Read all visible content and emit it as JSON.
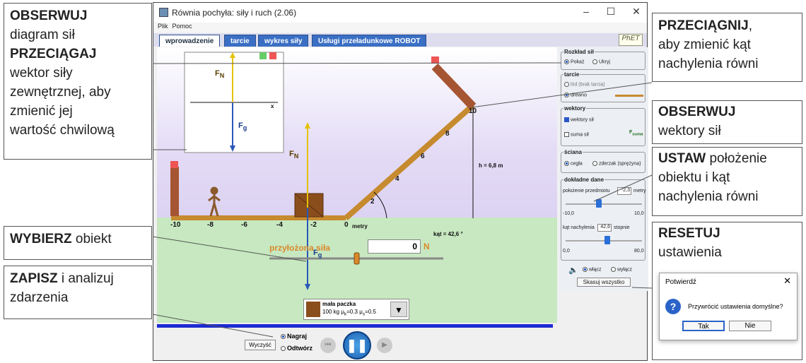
{
  "window": {
    "title": "Równia pochyła: siły i ruch (2.06)",
    "menu": [
      "Plik",
      "Pomoc"
    ],
    "tabs": [
      "wprowadzenie",
      "tarcie",
      "wykres siły",
      "Usługi przeładunkowe ROBOT"
    ],
    "logo": "PhET"
  },
  "fbd": {
    "fn": "F",
    "fn_sub": "N",
    "fg": "F",
    "fg_sub": "g",
    "axis": "x"
  },
  "scene": {
    "fn": "F",
    "fn_sub": "N",
    "fg": "F",
    "fg_sub": "g",
    "ticks": [
      "-10",
      "-8",
      "-6",
      "-4",
      "-2",
      "0"
    ],
    "ramp_ticks": [
      "2",
      "4",
      "6",
      "8",
      "10"
    ],
    "unit": "metry",
    "height": "h = 6,8 m",
    "angle": "kąt = 42,6 °",
    "applied_force_label": "przyłożona siła",
    "applied_force_value": "0",
    "applied_force_unit": "N",
    "object_name": "mała paczka",
    "object_mass": "100 kg",
    "mu_k": "=0.3",
    "mu_s": "=0.5",
    "mu": "μ",
    "k": "k",
    "s": "s"
  },
  "panel": {
    "forces_diagram": "Rozkład sił",
    "show": "Pokaż",
    "hide": "Ukryj",
    "friction": "tarcie",
    "ice": "lód (brak tarcia)",
    "wood": "drewno",
    "vectors": "wektory",
    "force_vectors": "wektory sił",
    "sum_of_forces": "suma sił",
    "fsum": "F",
    "fsum_sub": "suma",
    "wall": "ściana",
    "brick": "cegła",
    "spring": "zderzak (sprężyna)",
    "precise": "dokładne dane",
    "position_label": "położenie przedmiotu",
    "position_value": "-2,3",
    "position_unit": "metry",
    "pos_min": "-10,0",
    "pos_max": "10,0",
    "angle_label": "kąt nachylenia",
    "angle_value": "42,6",
    "angle_unit": "stopnie",
    "ang_min": "0,0",
    "ang_max": "80,0",
    "sound_on": "włącz",
    "sound_off": "wyłącz",
    "reset": "Skasuj wszystko"
  },
  "playback": {
    "clear": "Wyczyść",
    "record": "Nagraj",
    "playback": "Odtwórz"
  },
  "dialog": {
    "title": "Potwierdź",
    "message": "Przywrócić ustawienia domyślne?",
    "yes": "Tak",
    "no": "Nie"
  },
  "callouts": {
    "observe1_b": "OBSERWUJ",
    "observe1_t": "diagram sił",
    "drag_b": "PRZECIĄGAJ",
    "drag_t1": "wektor siły",
    "drag_t2": "zewnętrznej, aby",
    "drag_t3": "zmienić jej",
    "drag_t4": "wartość chwilową",
    "choose_b": "WYBIERZ",
    "choose_t": "obiekt",
    "save_b": "ZAPISZ",
    "save_t": "i analizuj",
    "save_t2": "zdarzenia",
    "pull_b": "PRZECIĄGNIJ",
    "pull_t1": ",",
    "pull_t2": "aby zmienić kąt",
    "pull_t3": "nachylenia równi",
    "observe2_b": "OBSERWUJ",
    "observe2_t": "wektory sił",
    "set_b": "USTAW",
    "set_t1": "położenie",
    "set_t2": "obiektu i kąt",
    "set_t3": "nachylenia równi",
    "reset_b": "RESETUJ",
    "reset_t": "ustawienia"
  }
}
